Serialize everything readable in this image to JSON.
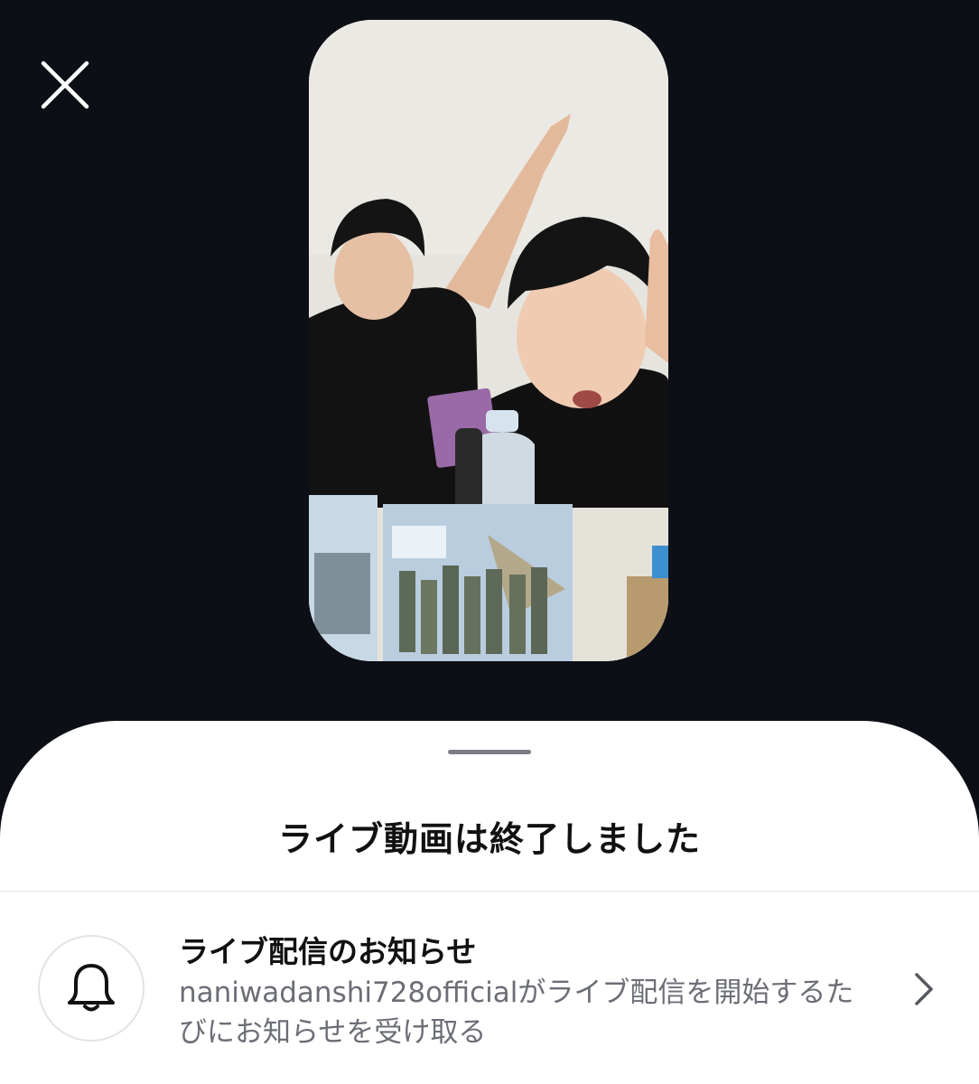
{
  "icons": {
    "close": "close-icon",
    "bell": "bell-icon",
    "chevron": "chevron-right-icon"
  },
  "colors": {
    "background": "#0c0f15",
    "sheet": "#ffffff",
    "title_text": "#111111",
    "secondary_text": "#6b6e76"
  },
  "sheet": {
    "title": "ライブ動画は終了しました"
  },
  "notification": {
    "title": "ライブ配信のお知らせ",
    "description": "naniwadanshi728officialがライブ配信を開始するたびにお知らせを受け取る"
  }
}
